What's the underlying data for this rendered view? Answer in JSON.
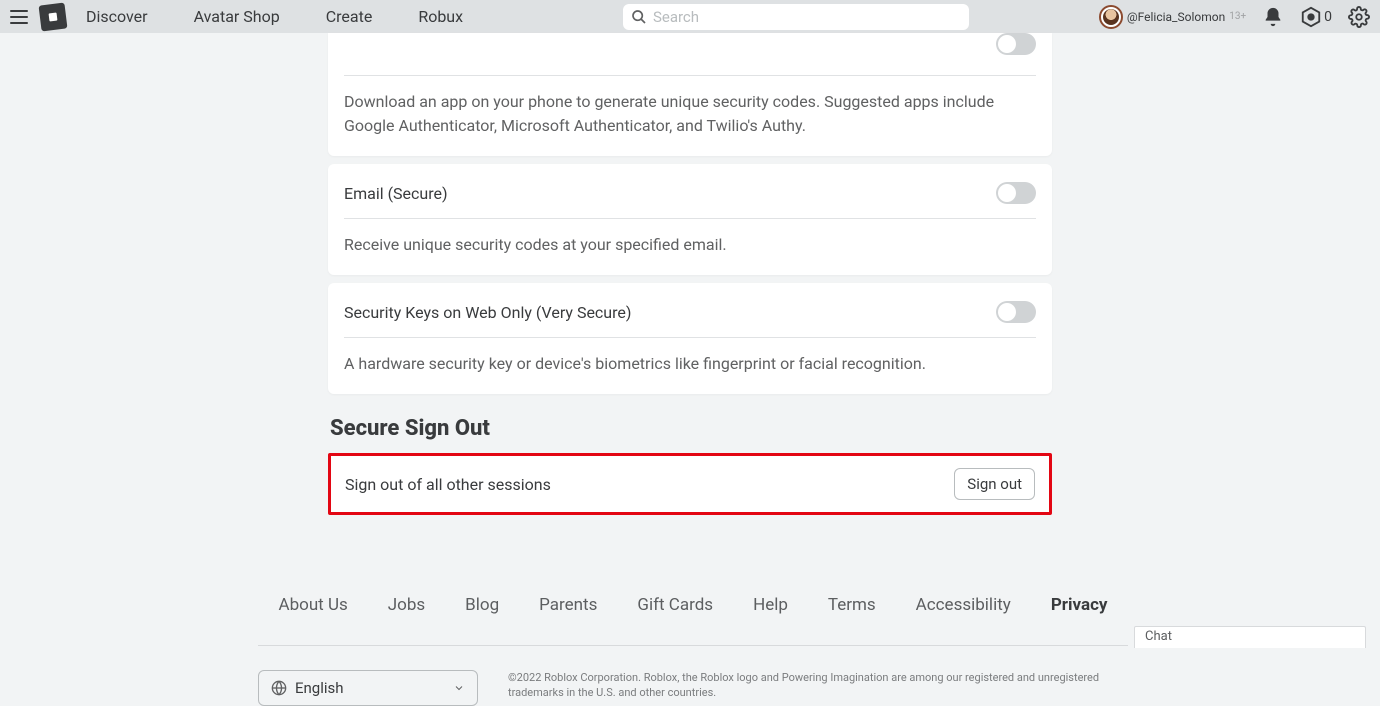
{
  "nav": {
    "links": [
      "Discover",
      "Avatar Shop",
      "Create",
      "Robux"
    ],
    "search_placeholder": "Search",
    "username": "@Felicia_Solomon",
    "age_badge": "13+",
    "robux_count": "0"
  },
  "settings": {
    "auth_app": {
      "title_cut": "",
      "desc": "Download an app on your phone to generate unique security codes. Suggested apps include Google Authenticator, Microsoft Authenticator, and Twilio's Authy."
    },
    "email": {
      "title": "Email (Secure)",
      "desc": "Receive unique security codes at your specified email."
    },
    "security_keys": {
      "title": "Security Keys on Web Only (Very Secure)",
      "desc": "A hardware security key or device's biometrics like fingerprint or facial recognition."
    },
    "secure_signout_heading": "Secure Sign Out",
    "secure_signout_label": "Sign out of all other sessions",
    "signout_button": "Sign out"
  },
  "footer": {
    "links": [
      "About Us",
      "Jobs",
      "Blog",
      "Parents",
      "Gift Cards",
      "Help",
      "Terms",
      "Accessibility",
      "Privacy"
    ],
    "active_link": "Privacy",
    "language": "English",
    "copyright": "©2022 Roblox Corporation. Roblox, the Roblox logo and Powering Imagination are among our registered and unregistered trademarks in the U.S. and other countries."
  },
  "chat": {
    "label": "Chat"
  }
}
